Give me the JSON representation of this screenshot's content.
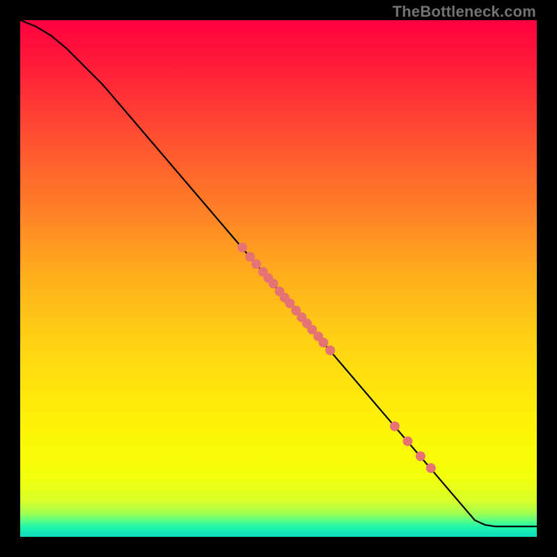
{
  "watermark": "TheBottleneck.com",
  "chart_data": {
    "type": "line",
    "title": "",
    "xlabel": "",
    "ylabel": "",
    "xlim": [
      0,
      100
    ],
    "ylim": [
      0,
      100
    ],
    "gradient_stops": [
      {
        "offset": 0.0,
        "color": "#ff0040"
      },
      {
        "offset": 0.08,
        "color": "#ff1a3a"
      },
      {
        "offset": 0.2,
        "color": "#ff4633"
      },
      {
        "offset": 0.35,
        "color": "#ff7a28"
      },
      {
        "offset": 0.5,
        "color": "#ffb01c"
      },
      {
        "offset": 0.65,
        "color": "#ffd812"
      },
      {
        "offset": 0.78,
        "color": "#fff208"
      },
      {
        "offset": 0.88,
        "color": "#f4ff0a"
      },
      {
        "offset": 0.93,
        "color": "#d8ff28"
      },
      {
        "offset": 0.955,
        "color": "#a0ff50"
      },
      {
        "offset": 0.968,
        "color": "#5eff82"
      },
      {
        "offset": 0.98,
        "color": "#22f5a8"
      },
      {
        "offset": 1.0,
        "color": "#0adfc0"
      }
    ],
    "curve": [
      {
        "x": 0.0,
        "y": 100.0
      },
      {
        "x": 3.0,
        "y": 98.8
      },
      {
        "x": 6.0,
        "y": 97.0
      },
      {
        "x": 9.0,
        "y": 94.5
      },
      {
        "x": 12.0,
        "y": 91.5
      },
      {
        "x": 16.0,
        "y": 87.5
      },
      {
        "x": 88.0,
        "y": 3.2
      },
      {
        "x": 90.0,
        "y": 2.3
      },
      {
        "x": 92.0,
        "y": 2.0
      },
      {
        "x": 100.0,
        "y": 2.0
      }
    ],
    "points": [
      {
        "x": 43.0,
        "y": 56.0
      },
      {
        "x": 44.5,
        "y": 54.2
      },
      {
        "x": 45.7,
        "y": 52.8
      },
      {
        "x": 47.0,
        "y": 51.3
      },
      {
        "x": 48.0,
        "y": 50.1
      },
      {
        "x": 49.0,
        "y": 49.0
      },
      {
        "x": 50.2,
        "y": 47.5
      },
      {
        "x": 51.2,
        "y": 46.3
      },
      {
        "x": 52.2,
        "y": 45.2
      },
      {
        "x": 53.4,
        "y": 43.8
      },
      {
        "x": 54.5,
        "y": 42.5
      },
      {
        "x": 55.5,
        "y": 41.3
      },
      {
        "x": 56.5,
        "y": 40.1
      },
      {
        "x": 57.7,
        "y": 38.8
      },
      {
        "x": 58.7,
        "y": 37.6
      },
      {
        "x": 60.0,
        "y": 36.1
      },
      {
        "x": 72.5,
        "y": 21.4
      },
      {
        "x": 75.0,
        "y": 18.5
      },
      {
        "x": 77.5,
        "y": 15.6
      },
      {
        "x": 79.5,
        "y": 13.3
      }
    ],
    "point_color": "#e57373",
    "point_radius": 7,
    "line_color": "#000000"
  }
}
